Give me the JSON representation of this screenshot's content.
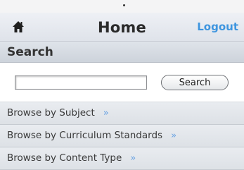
{
  "header": {
    "title": "Home",
    "logout_label": "Logout",
    "home_icon": "home-icon"
  },
  "search": {
    "heading": "Search",
    "input_value": "",
    "button_label": "Search"
  },
  "browse": {
    "items": [
      {
        "label": "Browse by Subject",
        "chevron": "»"
      },
      {
        "label": "Browse by Curriculum Standards",
        "chevron": "»"
      },
      {
        "label": "Browse by Content Type",
        "chevron": "»"
      }
    ]
  },
  "colors": {
    "link_blue": "#3e95df",
    "chevron_blue": "#6aa3e3"
  }
}
